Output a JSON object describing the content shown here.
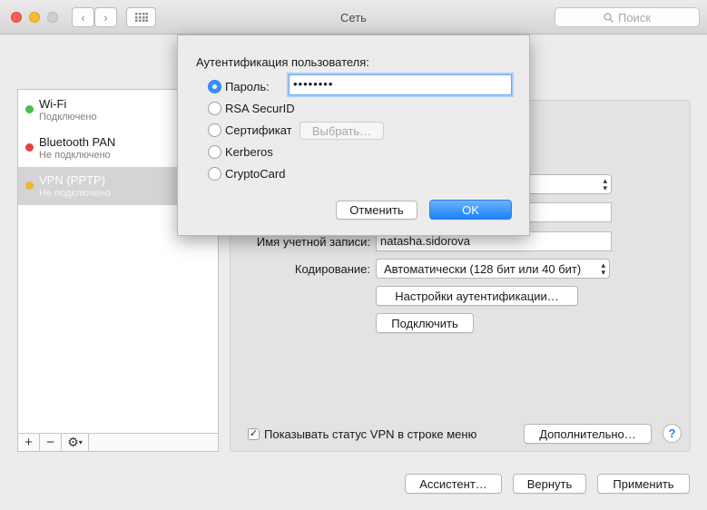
{
  "window": {
    "title": "Сеть",
    "search_placeholder": "Поиск"
  },
  "services": [
    {
      "name": "Wi-Fi",
      "status": "Подключено",
      "color": "#3fc14b"
    },
    {
      "name": "Bluetooth PAN",
      "status": "Не подключено",
      "color": "#e84040"
    },
    {
      "name": "VPN (PPTP)",
      "status": "Не подключено",
      "color": "#f2b233",
      "selected": true
    }
  ],
  "sidebar_bar": {
    "add": "+",
    "remove": "−"
  },
  "vpn": {
    "account_label": "Имя учетной записи:",
    "account_value": "natasha.sidorova",
    "encoding_label": "Кодирование:",
    "encoding_value": "Автоматически (128 бит или 40 бит)",
    "auth_settings_button": "Настройки аутентификации…",
    "connect_button": "Подключить",
    "show_status_checkbox": "Показывать статус VPN в строке меню",
    "show_status_checked": true,
    "advanced_button": "Дополнительно…",
    "help": "?"
  },
  "footer": {
    "assistant": "Ассистент…",
    "revert": "Вернуть",
    "apply": "Применить"
  },
  "sheet": {
    "title": "Аутентификация пользователя:",
    "options": [
      {
        "label": "Пароль:",
        "selected": true
      },
      {
        "label": "RSA SecurID",
        "selected": false
      },
      {
        "label": "Сертификат",
        "selected": false
      },
      {
        "label": "Kerberos",
        "selected": false
      },
      {
        "label": "CryptoCard",
        "selected": false
      }
    ],
    "password_value": "••••••••",
    "choose_button": "Выбрать…",
    "cancel_button": "Отменить",
    "ok_button": "OK"
  }
}
